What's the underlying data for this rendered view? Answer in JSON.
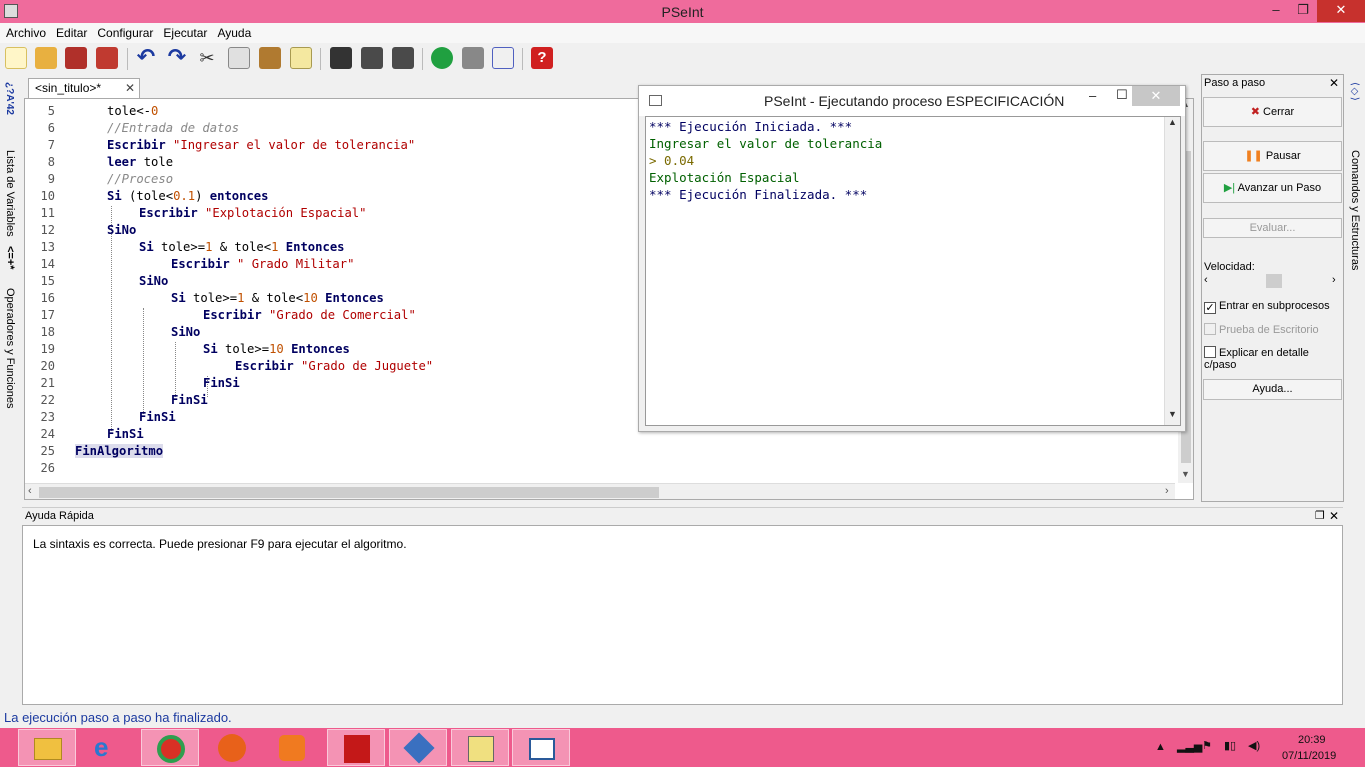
{
  "window": {
    "title": "PSeInt",
    "minimize": "–",
    "maximize": "❐",
    "close": "✕"
  },
  "menu": [
    "Archivo",
    "Editar",
    "Configurar",
    "Ejecutar",
    "Ayuda"
  ],
  "toolbar_icons": [
    "new-file-icon",
    "open-folder-icon",
    "save-icon",
    "save-as-icon",
    "undo-icon",
    "redo-icon",
    "cut-icon",
    "copy-icon",
    "paste-icon",
    "edit-icon",
    "find-icon",
    "find-previous-icon",
    "find-next-icon",
    "run-icon",
    "step-by-step-icon",
    "flowchart-icon",
    "help-icon"
  ],
  "left_tabs": {
    "variables": "Lista de Variables",
    "operators": "Operadores y Funciones"
  },
  "right_tabs": {
    "commands": "Comandos y Estructuras"
  },
  "editor": {
    "tab_label": "<sin_titulo>*",
    "tab_close": "✕",
    "line_numbers": [
      "5",
      "6",
      "7",
      "8",
      "9",
      "10",
      "11",
      "12",
      "13",
      "14",
      "15",
      "16",
      "17",
      "18",
      "19",
      "20",
      "21",
      "22",
      "23",
      "24",
      "25",
      "26"
    ]
  },
  "console": {
    "title": "PSeInt - Ejecutando proceso ESPECIFICACIÓN",
    "close": "✕",
    "lines": [
      "*** Ejecución Iniciada. ***",
      "Ingresar el valor de tolerancia",
      "> 0.04",
      "Explotación Espacial",
      "*** Ejecución Finalizada. ***"
    ]
  },
  "step_panel": {
    "title": "Paso a paso",
    "close": "✕",
    "close_button": "Cerrar",
    "pause_button": "Pausar",
    "step_button": "Avanzar un Paso",
    "evaluate_button": "Evaluar...",
    "speed_label": "Velocidad:",
    "enter_subprocesses": "Entrar en subprocesos",
    "desk_check": "Prueba de Escritorio",
    "explain_detail": "Explicar en detalle c/paso",
    "help_button": "Ayuda...",
    "enter_subprocesses_checked": true
  },
  "quick_help": {
    "title": "Ayuda Rápida",
    "message": "La sintaxis es correcta. Puede presionar F9 para ejecutar el algoritmo."
  },
  "status_bar": "La ejecución paso a paso ha finalizado.",
  "taskbar": {
    "apps": [
      "file-explorer-icon",
      "internet-explorer-icon",
      "chrome-icon",
      "firefox-icon",
      "media-player-icon",
      "acrobat-icon",
      "git-icon",
      "pseint-icon",
      "window-app-icon"
    ],
    "time": "20:39",
    "date": "07/11/2019"
  }
}
